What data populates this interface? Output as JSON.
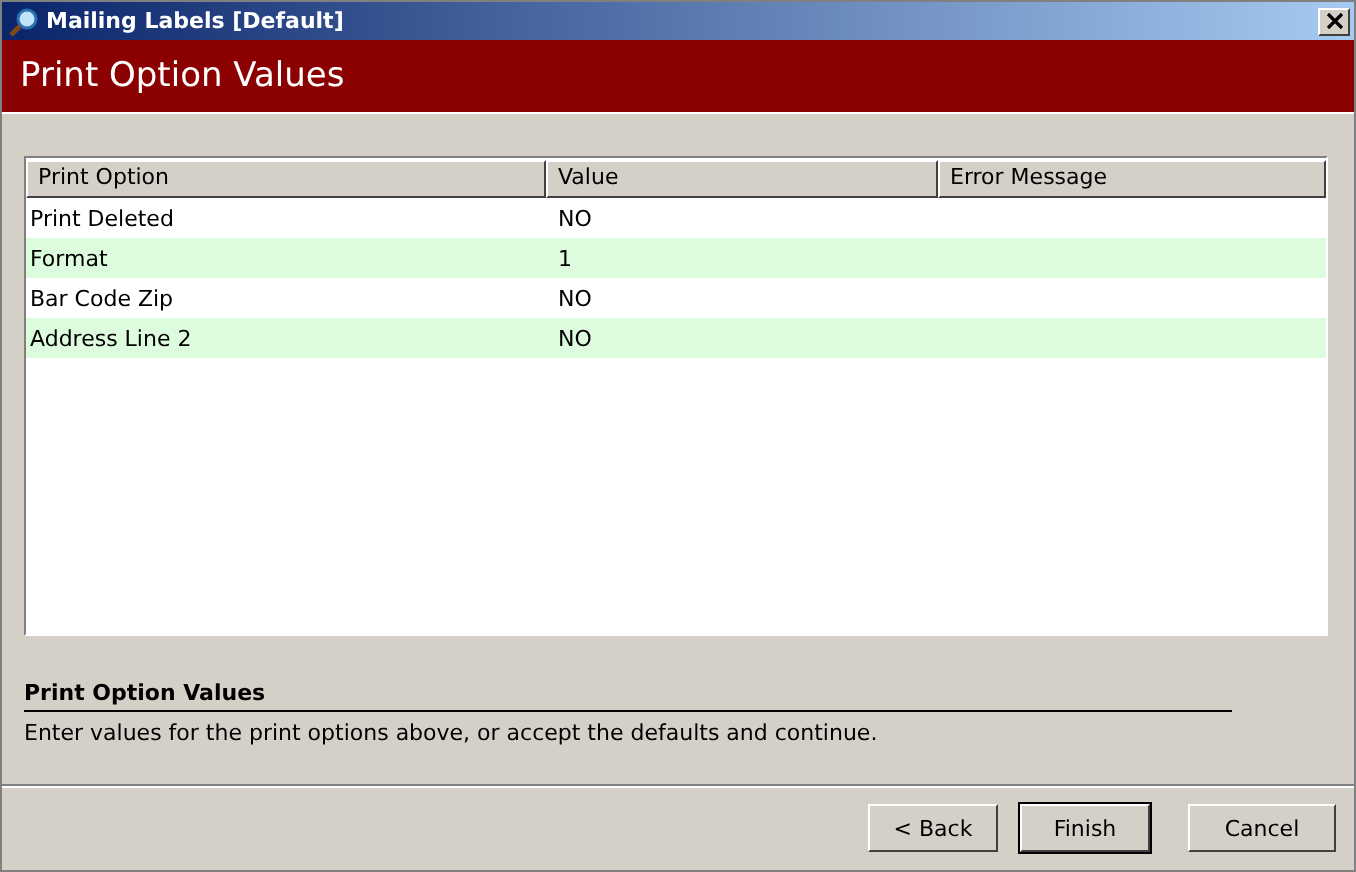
{
  "window": {
    "title": "Mailing Labels [Default]"
  },
  "header": {
    "title": "Print Option Values"
  },
  "table": {
    "columns": [
      "Print Option",
      "Value",
      "Error Message"
    ],
    "rows": [
      {
        "option": "Print Deleted",
        "value": "NO"
      },
      {
        "option": "Format",
        "value": "1"
      },
      {
        "option": "Bar Code Zip",
        "value": "NO"
      },
      {
        "option": "Address Line 2",
        "value": "NO"
      }
    ]
  },
  "help": {
    "title": "Print Option Values",
    "text": "Enter values for the print options above, or accept the defaults and continue."
  },
  "buttons": [
    {
      "label": "< Back",
      "default": false
    },
    {
      "label": "Finish",
      "default": true
    },
    {
      "label": "Cancel",
      "default": false
    }
  ]
}
